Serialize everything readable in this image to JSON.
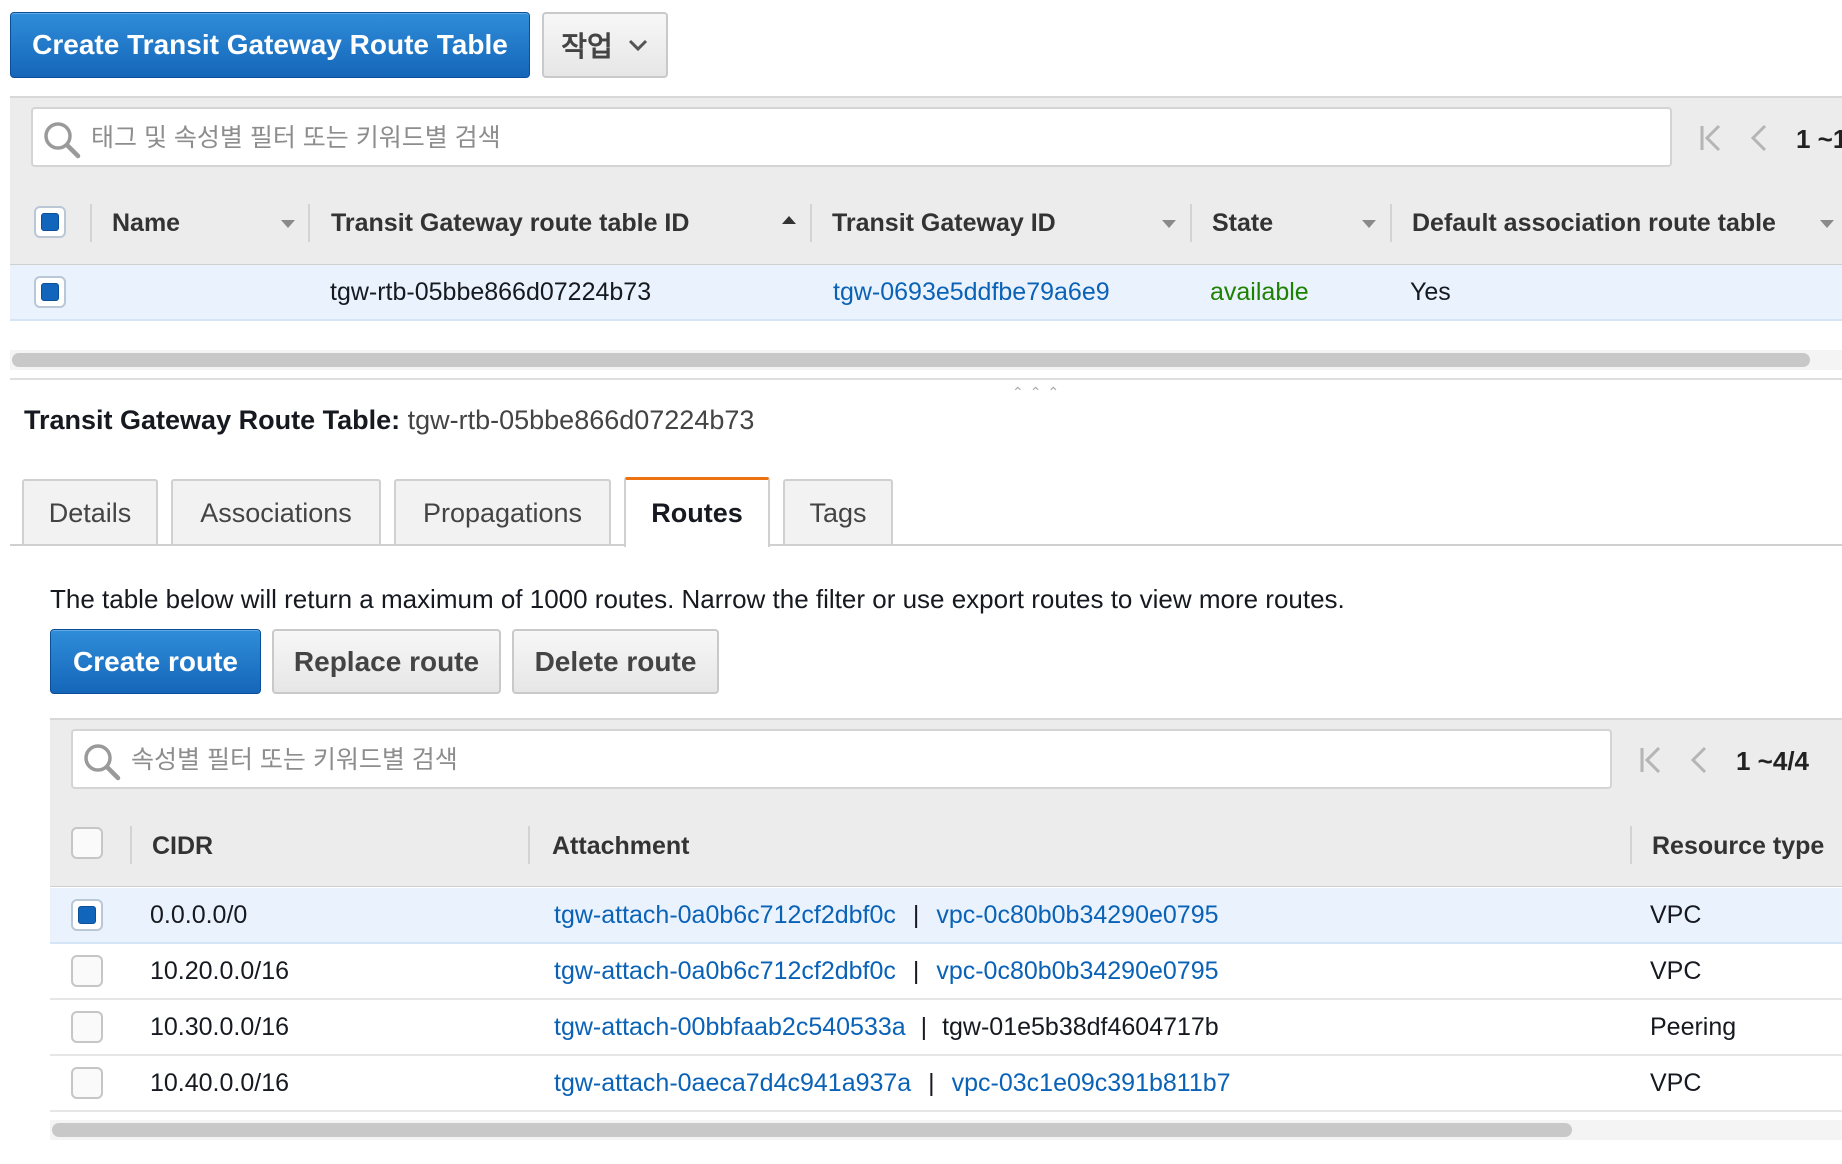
{
  "toolbar": {
    "create_button_label": "Create Transit Gateway Route Table",
    "actions_button_label": "작업"
  },
  "top_filter": {
    "placeholder": "태그 및 속성별 필터 또는 키워드별 검색",
    "pager_text": "1 ~1"
  },
  "top_table": {
    "columns": {
      "name": "Name",
      "route_table_id": "Transit Gateway route table ID",
      "tgw_id": "Transit Gateway ID",
      "state": "State",
      "default_assoc": "Default association route table"
    },
    "rows": [
      {
        "name": "",
        "route_table_id": "tgw-rtb-05bbe866d07224b73",
        "tgw_id": "tgw-0693e5ddfbe79a6e9",
        "state": "available",
        "default_assoc": "Yes",
        "selected": true
      }
    ]
  },
  "detail": {
    "title_label": "Transit Gateway Route Table:",
    "title_value": "tgw-rtb-05bbe866d07224b73",
    "tabs": [
      {
        "label": "Details"
      },
      {
        "label": "Associations"
      },
      {
        "label": "Propagations"
      },
      {
        "label": "Routes",
        "active": true
      },
      {
        "label": "Tags"
      }
    ],
    "notice": "The table below will return a maximum of 1000 routes. Narrow the filter or use export routes to view more routes.",
    "buttons": {
      "create_route": "Create route",
      "replace_route": "Replace route",
      "delete_route": "Delete route"
    }
  },
  "routes_filter": {
    "placeholder": "속성별 필터 또는 키워드별 검색",
    "pager_text": "1 ~4/4"
  },
  "routes_table": {
    "columns": {
      "cidr": "CIDR",
      "attachment": "Attachment",
      "resource_type": "Resource type"
    },
    "separator": "|",
    "rows": [
      {
        "cidr": "0.0.0.0/0",
        "attachment": "tgw-attach-0a0b6c712cf2dbf0c",
        "resource": "vpc-0c80b0b34290e0795",
        "resource_is_link": true,
        "type": "VPC",
        "selected": true
      },
      {
        "cidr": "10.20.0.0/16",
        "attachment": "tgw-attach-0a0b6c712cf2dbf0c",
        "resource": "vpc-0c80b0b34290e0795",
        "resource_is_link": true,
        "type": "VPC",
        "selected": false
      },
      {
        "cidr": "10.30.0.0/16",
        "attachment": "tgw-attach-00bbfaab2c540533a",
        "resource": "tgw-01e5b38df4604717b",
        "resource_is_link": false,
        "type": "Peering",
        "selected": false
      },
      {
        "cidr": "10.40.0.0/16",
        "attachment": "tgw-attach-0aeca7d4c941a937a",
        "resource": "vpc-03c1e09c391b811b7",
        "resource_is_link": true,
        "type": "VPC",
        "selected": false
      }
    ]
  }
}
